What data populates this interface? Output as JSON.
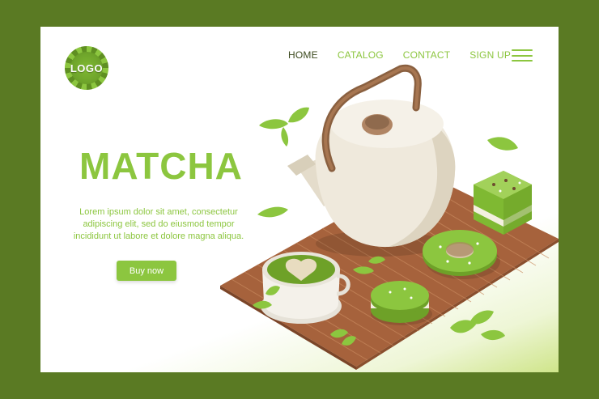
{
  "logo": {
    "text": "LOGO"
  },
  "nav": {
    "items": [
      "HOME",
      "CATALOG",
      "CONTACT",
      "SIGN UP"
    ]
  },
  "hero": {
    "title": "MATCHA",
    "text": "Lorem ipsum dolor sit amet, consectetur adipiscing elit, sed do eiusmod tempor incididunt ut labore et dolore magna aliqua.",
    "button_label": "Buy now"
  },
  "colors": {
    "frame": "#5a7a23",
    "accent": "#8cc63f",
    "nav_active": "#3c4a1e",
    "mat": "#b06a43",
    "teapot": "#efe9dc"
  },
  "icons": [
    "hamburger-menu-icon",
    "logo-swirl-icon"
  ]
}
